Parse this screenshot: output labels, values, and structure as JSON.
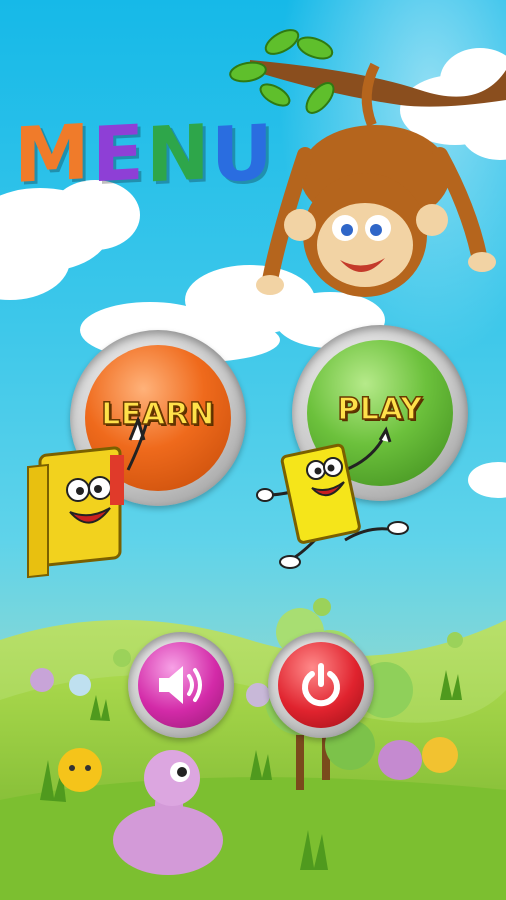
{
  "title": {
    "letters": [
      {
        "char": "M",
        "color": "#f07b2a"
      },
      {
        "char": "E",
        "color": "#8e3fd6"
      },
      {
        "char": "N",
        "color": "#2ea64a"
      },
      {
        "char": "U",
        "color": "#2a6de0"
      }
    ]
  },
  "buttons": {
    "learn": {
      "label": "LEARN",
      "color": "#e8651c"
    },
    "play": {
      "label": "PLAY",
      "color": "#5fb935"
    },
    "sound": {
      "icon": "speaker-icon",
      "color": "#d32aa8"
    },
    "power": {
      "icon": "power-icon",
      "color": "#e0232e"
    }
  },
  "colors": {
    "sky": "#16b9e8",
    "grass": "#9bd046",
    "cloud": "#ffffff"
  }
}
